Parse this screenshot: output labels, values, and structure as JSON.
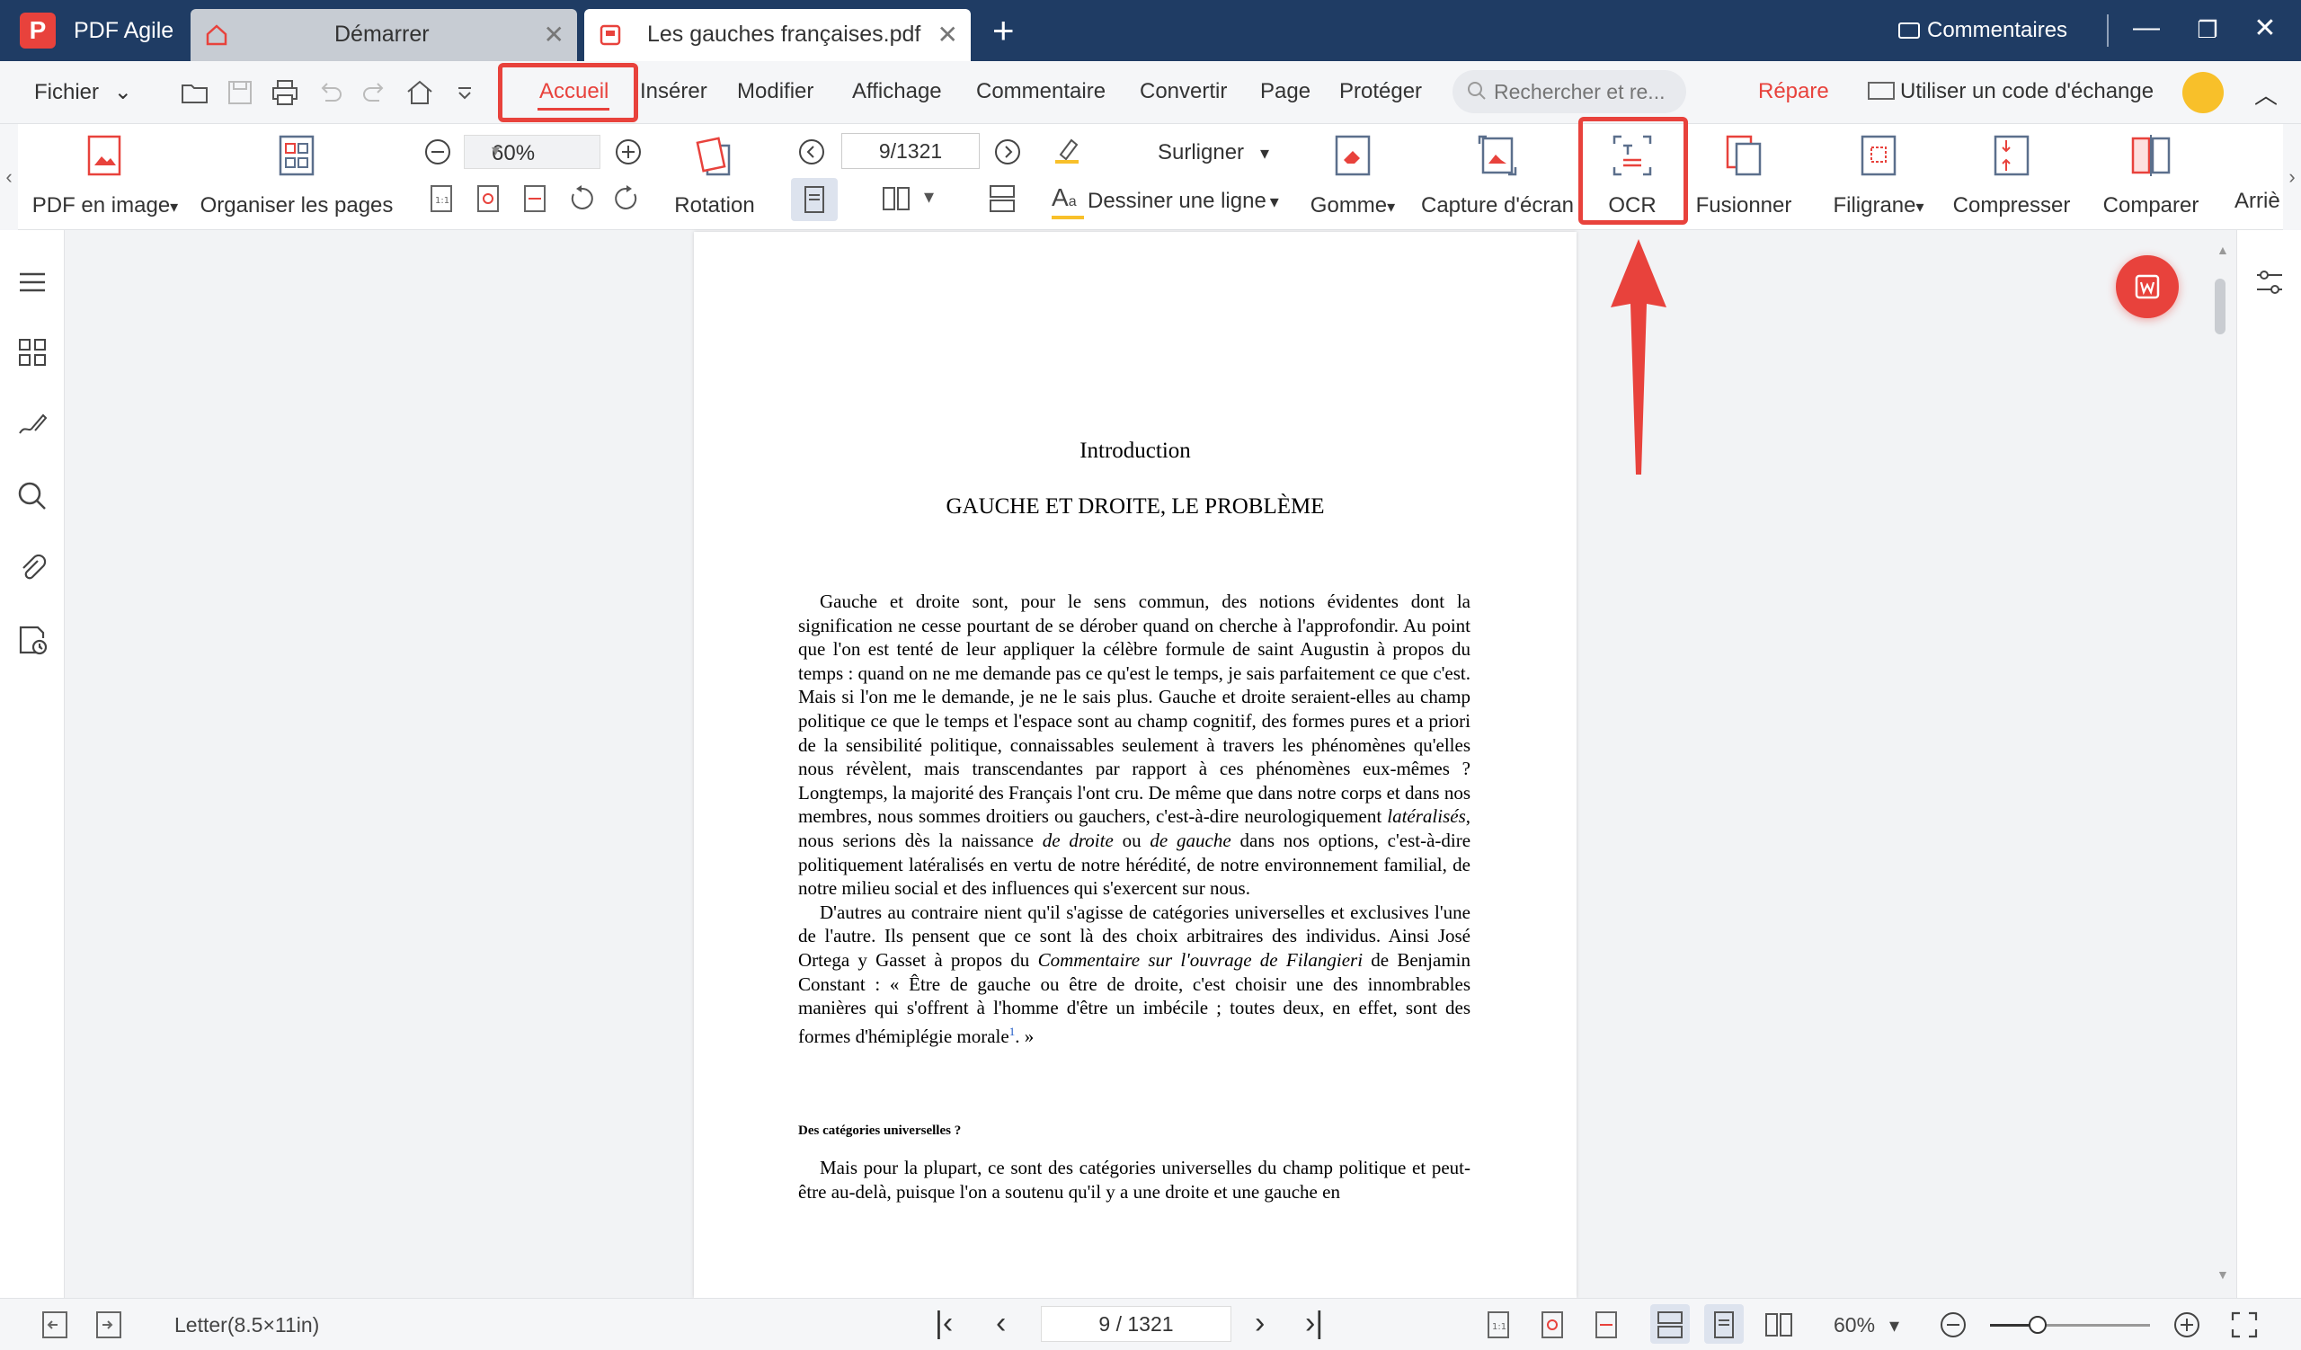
{
  "app": {
    "name": "PDF Agile",
    "logo_letter": "P"
  },
  "tabs": [
    {
      "label": "Démarrer",
      "close": "✕"
    },
    {
      "label": "Les gauches françaises.pdf",
      "close": "✕"
    }
  ],
  "new_tab": "+",
  "titlebar": {
    "comments": "Commentaires",
    "minimize": "—",
    "restore": "❐",
    "close": "✕"
  },
  "menu": {
    "fichier": "Fichier",
    "fichier_chevron": "⌄",
    "items": [
      "Accueil",
      "Insérer",
      "Modifier",
      "Affichage",
      "Commentaire",
      "Convertir",
      "Page",
      "Protéger"
    ],
    "search_placeholder": "Rechercher et re...",
    "repare": "Répare",
    "exchange": "Utiliser un code d'échange",
    "collapse": "︿"
  },
  "ribbon": {
    "pdf_to_image": "PDF en image",
    "organize": "Organiser les pages",
    "zoom_value": "60%",
    "rotation": "Rotation",
    "page_value": "9/1321",
    "surligner": "Surligner",
    "dessiner": "Dessiner une ligne",
    "gomme": "Gomme",
    "capture": "Capture d'écran",
    "ocr": "OCR",
    "fusionner": "Fusionner",
    "filigrane": "Filigrane",
    "compresser": "Compresser",
    "comparer": "Comparer",
    "arriere": "Arriè",
    "dropdown_arrow": "▾"
  },
  "document": {
    "heading1": "Introduction",
    "heading2": "GAUCHE ET DROITE, LE PROBLÈME",
    "p1": "Gauche et droite sont, pour le sens commun, des notions évidentes dont la signification ne cesse pourtant de se dérober quand on cherche à l'approfondir. Au point que l'on est tenté de leur appliquer la célèbre formule de saint Augustin à propos du temps : quand on ne me demande pas ce qu'est le temps, je sais parfaitement ce que c'est. Mais si l'on me le demande, je ne le sais plus. Gauche et droite seraient-elles au champ politique ce que le temps et l'espace sont au champ cognitif, des formes pures et a priori de la sensibilité politique, connaissables seulement à travers les phénomènes qu'elles nous révèlent, mais transcendantes par rapport à ces phénomènes eux-mêmes ? Longtemps, la majorité des Français l'ont cru. De même que dans notre corps et dans nos membres, nous sommes droitiers ou gauchers, c'est-à-dire neurologiquement",
    "p1_it1": "latéralisés",
    "p1_b": ", nous serions dès la naissance",
    "p1_it2": "de droite",
    "p1_c": "ou",
    "p1_it3": "de gauche",
    "p1_d": "dans nos options, c'est-à-dire politiquement latéralisés en vertu de notre hérédité, de notre environnement familial, de notre milieu social et des influences qui s'exercent sur nous.",
    "p2_a": "D'autres au contraire nient qu'il s'agisse de catégories universelles et exclusives l'une de l'autre. Ils pensent que ce sont là des choix arbitraires des individus. Ainsi José Ortega y Gasset à propos du",
    "p2_it": "Commentaire sur l'ouvrage de Filangieri",
    "p2_b": "de Benjamin Constant : « Être de gauche ou être de droite, c'est choisir une des innombrables manières qui s'offrent à l'homme d'être un imbécile ; toutes deux, en effet, sont des formes d'hémiplégie morale",
    "p2_sup": "1",
    "p2_c": ". »",
    "subheading": "Des catégories universelles ?",
    "p3": "Mais pour la plupart, ce sont des catégories universelles du champ politique et peut-être au-delà, puisque l'on a soutenu qu'il y a une droite et une gauche en"
  },
  "statusbar": {
    "paper": "Letter(8.5×11in)",
    "first": "|‹",
    "prev": "‹",
    "page": "9 / 1321",
    "next": "›",
    "last": "›|",
    "zoom": "60%",
    "zoom_level": 0.3
  },
  "colors": {
    "accent": "#e8423c",
    "titlebar": "#1f3c64"
  }
}
